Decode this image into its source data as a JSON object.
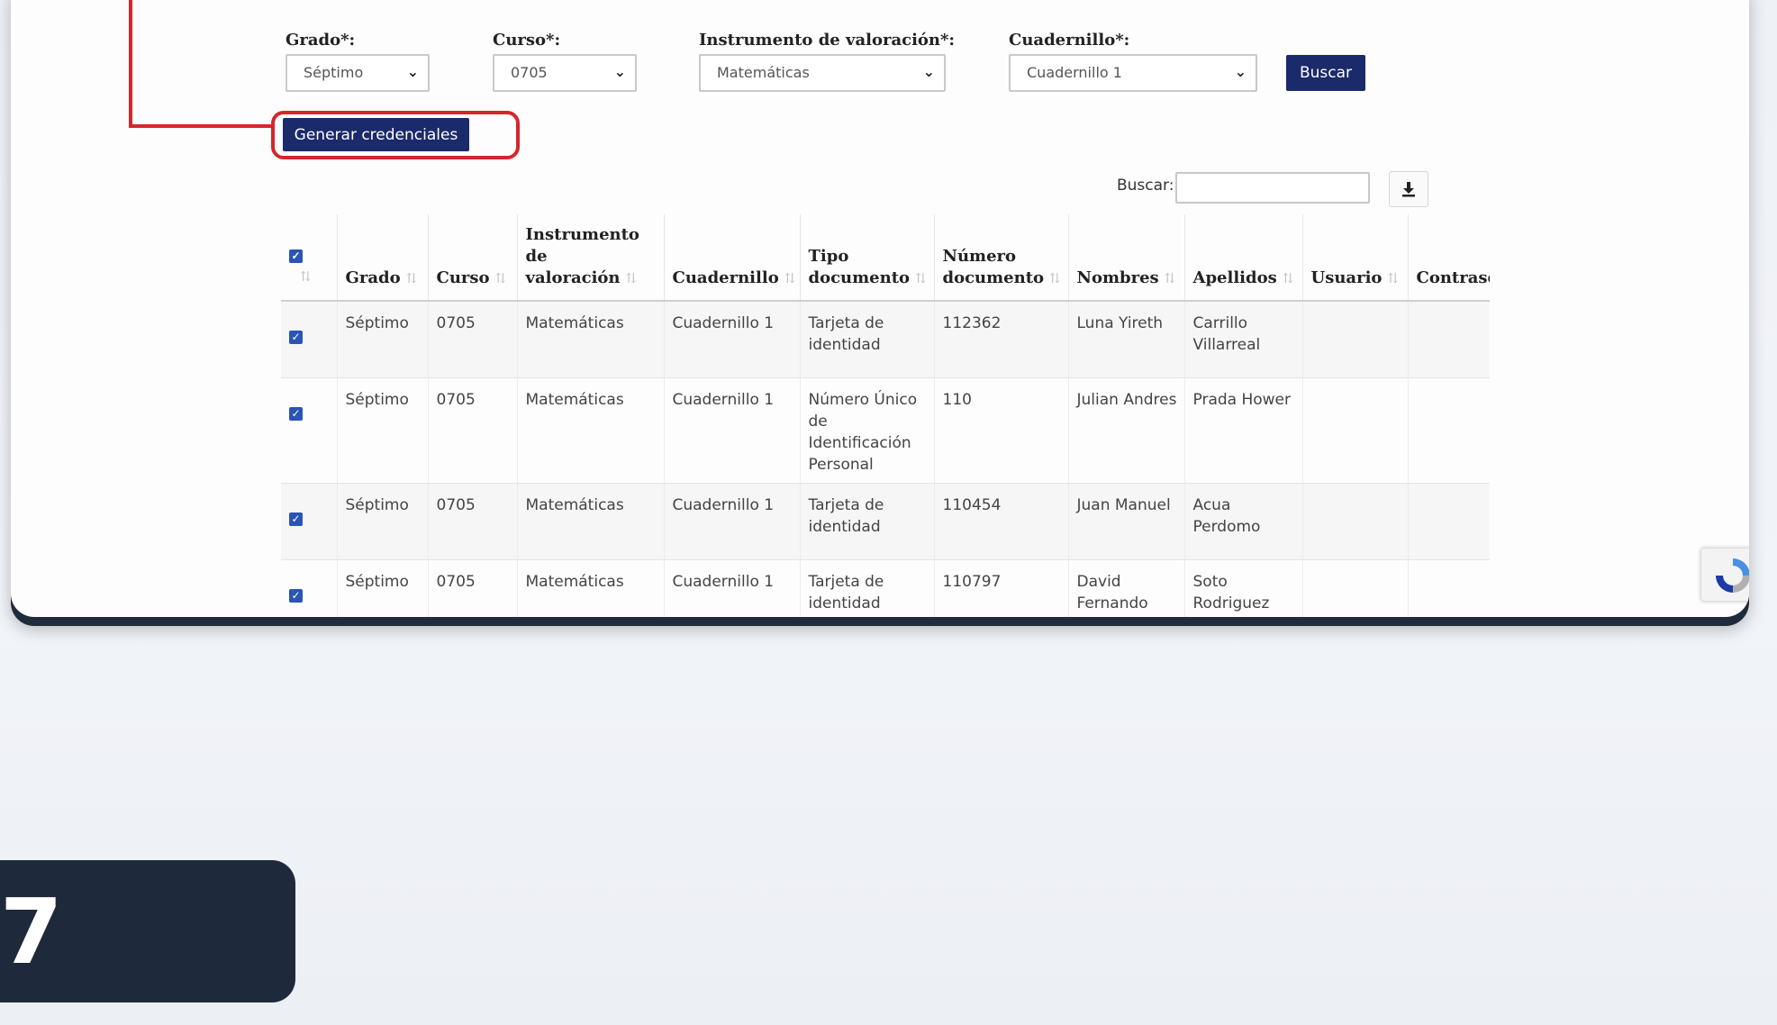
{
  "filters": {
    "grado": {
      "label": "Grado*:",
      "value": "Séptimo"
    },
    "curso": {
      "label": "Curso*:",
      "value": "0705"
    },
    "instrumento": {
      "label": "Instrumento de valoración*:",
      "value": "Matemáticas"
    },
    "cuadernillo": {
      "label": "Cuadernillo*:",
      "value": "Cuadernillo 1"
    },
    "buscar_button": "Buscar"
  },
  "generate_button": "Generar credenciales",
  "search": {
    "label": "Buscar:",
    "value": ""
  },
  "table": {
    "headers": {
      "grado": "Grado",
      "curso": "Curso",
      "instrumento": "Instrumento de valoración",
      "cuadernillo": "Cuadernillo",
      "tipo": "Tipo documento",
      "numero": "Número documento",
      "nombres": "Nombres",
      "apellidos": "Apellidos",
      "usuario": "Usuario",
      "contrasena": "Contrase"
    },
    "rows": [
      {
        "grado": "Séptimo",
        "curso": "0705",
        "instrumento": "Matemáticas",
        "cuadernillo": "Cuadernillo 1",
        "tipo": "Tarjeta de identidad",
        "numero": "112362",
        "nombres": "Luna Yireth",
        "apellidos": "Carrillo Villarreal",
        "usuario": "",
        "contrasena": ""
      },
      {
        "grado": "Séptimo",
        "curso": "0705",
        "instrumento": "Matemáticas",
        "cuadernillo": "Cuadernillo 1",
        "tipo": "Número Único de Identificación Personal",
        "numero": "110",
        "nombres": "Julian Andres",
        "apellidos": "Prada Hower",
        "usuario": "",
        "contrasena": ""
      },
      {
        "grado": "Séptimo",
        "curso": "0705",
        "instrumento": "Matemáticas",
        "cuadernillo": "Cuadernillo 1",
        "tipo": "Tarjeta de identidad",
        "numero": "110454",
        "nombres": "Juan Manuel",
        "apellidos": "Acua Perdomo",
        "usuario": "",
        "contrasena": ""
      },
      {
        "grado": "Séptimo",
        "curso": "0705",
        "instrumento": "Matemáticas",
        "cuadernillo": "Cuadernillo 1",
        "tipo": "Tarjeta de identidad",
        "numero": "110797",
        "nombres": "David Fernando",
        "apellidos": "Soto Rodriguez",
        "usuario": "",
        "contrasena": ""
      }
    ]
  },
  "step_number": "7",
  "colors": {
    "navy": "#1b2a6a",
    "highlight": "#d6262b",
    "badge": "#1e2a3b"
  }
}
